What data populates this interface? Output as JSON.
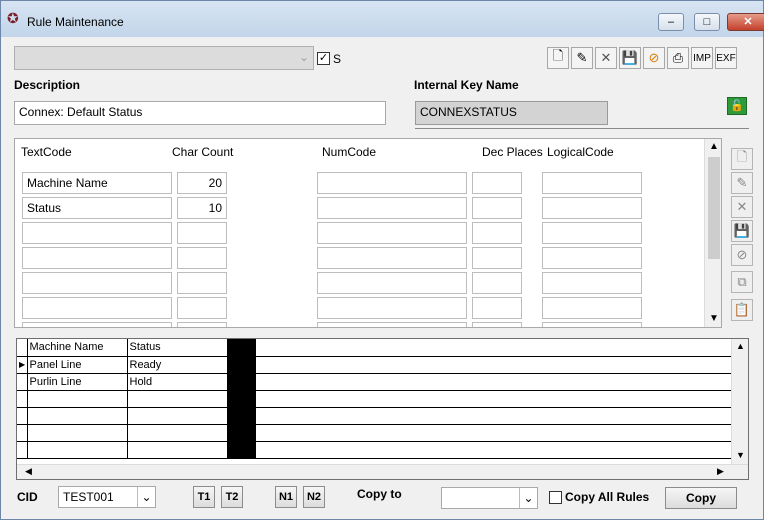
{
  "window": {
    "title": "Rule Maintenance",
    "min": "–",
    "max": "□",
    "close": "✕"
  },
  "top": {
    "checkbox_label": "S",
    "checkbox_checked": true
  },
  "toolbar": {
    "imp": "IMP",
    "exf": "EXF"
  },
  "description": {
    "label": "Description",
    "value": "Connex: Default Status"
  },
  "internal_key": {
    "label": "Internal Key Name",
    "value": "CONNEXSTATUS"
  },
  "fields": {
    "headers": {
      "text_code": "TextCode",
      "char_count": "Char Count",
      "num_code": "NumCode",
      "dec_places": "Dec Places",
      "logical_code": "LogicalCode"
    },
    "rows": [
      {
        "text": "Machine Name",
        "count": "20"
      },
      {
        "text": "Status",
        "count": "10"
      }
    ]
  },
  "grid": {
    "headers": [
      "Machine Name",
      "Status"
    ],
    "rows": [
      [
        "Panel Line",
        "Ready"
      ],
      [
        "Purlin Line",
        "Hold"
      ]
    ]
  },
  "bottom": {
    "cid_label": "CID",
    "cid_value": "TEST001",
    "t1": "T1",
    "t2": "T2",
    "n1": "N1",
    "n2": "N2",
    "copy_to_label": "Copy to",
    "copy_all_label": "Copy All Rules",
    "copy_button": "Copy"
  }
}
